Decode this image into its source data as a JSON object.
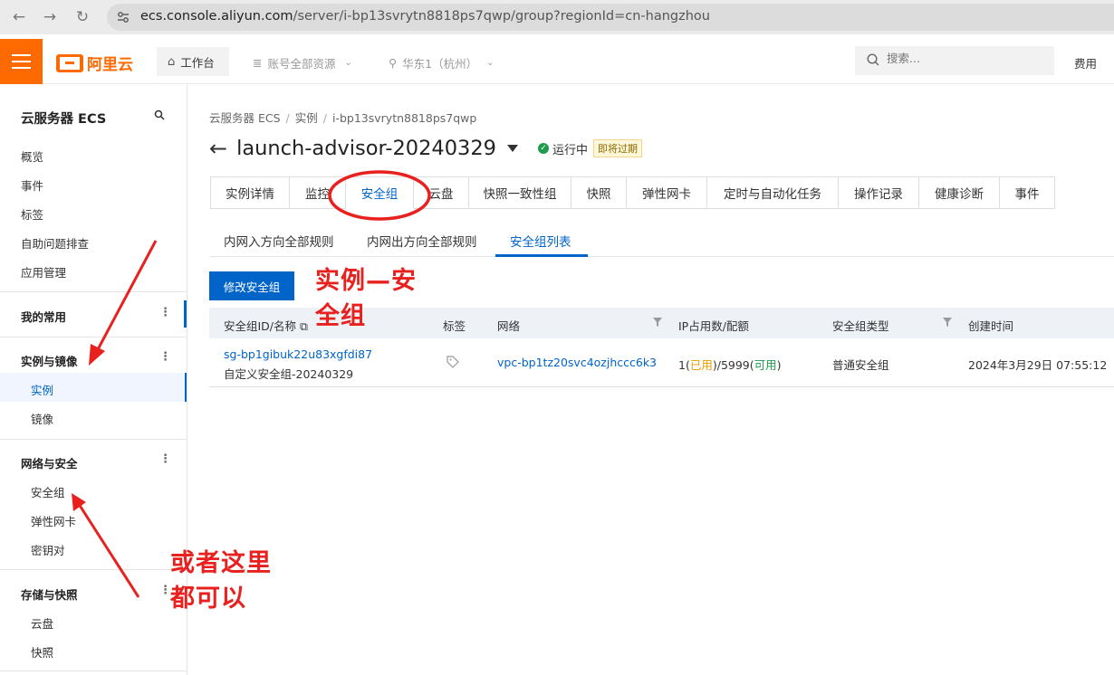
{
  "browser": {
    "url_host": "ecs.console.aliyun.com",
    "url_path": "/server/i-bp13svrytn8818ps7qwp/group?regionId=cn-hangzhou"
  },
  "topbar": {
    "logo_text": "阿里云",
    "workbench": "工作台",
    "resources": "账号全部资源",
    "region": "华东1（杭州）",
    "search_placeholder": "搜索...",
    "fees": "费用"
  },
  "sidebar": {
    "title": "云服务器 ECS",
    "items": [
      "概览",
      "事件",
      "标签",
      "自助问题排查",
      "应用管理"
    ],
    "groups": [
      {
        "label": "我的常用",
        "items": []
      },
      {
        "label": "实例与镜像",
        "items": [
          "实例",
          "镜像"
        ]
      },
      {
        "label": "网络与安全",
        "items": [
          "安全组",
          "弹性网卡",
          "密钥对"
        ]
      },
      {
        "label": "存储与快照",
        "items": [
          "云盘",
          "快照"
        ]
      }
    ],
    "active_item": "实例"
  },
  "main": {
    "breadcrumb": [
      "云服务器 ECS",
      "实例",
      "i-bp13svrytn8818ps7qwp"
    ],
    "title": "launch-advisor-20240329",
    "status": "运行中",
    "expire_badge": "即将过期",
    "tabs": [
      "实例详情",
      "监控",
      "安全组",
      "云盘",
      "快照一致性组",
      "快照",
      "弹性网卡",
      "定时与自动化任务",
      "操作记录",
      "健康诊断",
      "事件"
    ],
    "active_tab": "安全组",
    "subtabs": [
      "内网入方向全部规则",
      "内网出方向全部规则",
      "安全组列表"
    ],
    "active_subtab": "安全组列表",
    "modify_button": "修改安全组",
    "table": {
      "headers": [
        "安全组ID/名称",
        "标签",
        "网络",
        "IP占用数/配额",
        "安全组类型",
        "创建时间"
      ],
      "rows": [
        {
          "id": "sg-bp1gibuk22u83xgfdi87",
          "name": "自定义安全组-20240329",
          "network": "vpc-bp1tz20svc4ozjhccc6k3",
          "ip_used": "1",
          "ip_used_label": "已用",
          "ip_quota": "5999",
          "ip_quota_label": "可用",
          "type": "普通安全组",
          "created": "2024年3月29日 07:55:12"
        }
      ]
    }
  },
  "annotations": {
    "note1_line1": "实例—安",
    "note1_line2": "全组",
    "note2_line1": "或者这里",
    "note2_line2": "都可以",
    "color": "#e8201e"
  },
  "colors": {
    "accent": "#0064c8",
    "brand": "#ff6a00",
    "success": "#1e9b4c",
    "used": "#e69b00"
  }
}
